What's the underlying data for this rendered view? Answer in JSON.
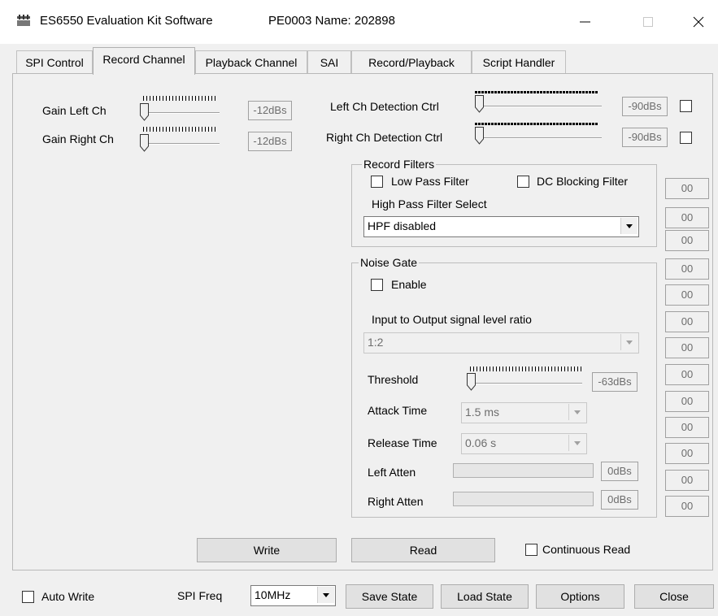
{
  "window": {
    "title": "ES6550 Evaluation Kit Software",
    "subtitle": "PE0003 Name: 202898",
    "minimize_icon": "minimize-icon",
    "maximize_icon": "maximize-icon",
    "close_icon": "close-icon"
  },
  "tabs": [
    {
      "label": "SPI Control"
    },
    {
      "label": "Record Channel"
    },
    {
      "label": "Playback Channel"
    },
    {
      "label": "SAI"
    },
    {
      "label": "Record/Playback"
    },
    {
      "label": "Script Handler"
    }
  ],
  "gain": {
    "left_label": "Gain Left Ch",
    "left_value": "-12dBs",
    "right_label": "Gain Right Ch",
    "right_value": "-12dBs"
  },
  "detection": {
    "left_label": "Left Ch Detection Ctrl",
    "left_value": "-90dBs",
    "right_label": "Right Ch Detection Ctrl",
    "right_value": "-90dBs"
  },
  "record_filters": {
    "legend": "Record Filters",
    "low_pass_label": "Low Pass Filter",
    "dc_blocking_label": "DC Blocking Filter",
    "hpf_label": "High Pass Filter Select",
    "hpf_value": "HPF disabled"
  },
  "noise_gate": {
    "legend": "Noise Gate",
    "enable_label": "Enable",
    "ratio_label": "Input to Output signal level ratio",
    "ratio_value": "1:2",
    "threshold_label": "Threshold",
    "threshold_value": "-63dBs",
    "attack_label": "Attack Time",
    "attack_value": "1.5 ms",
    "release_label": "Release Time",
    "release_value": "0.06 s",
    "left_atten_label": "Left Atten",
    "left_atten_value": "0dBs",
    "right_atten_label": "Right Atten",
    "right_atten_value": "0dBs"
  },
  "register_values": [
    "00",
    "00",
    "00",
    "00",
    "00",
    "00",
    "00",
    "00",
    "00",
    "00",
    "00",
    "00",
    "00",
    "00"
  ],
  "actions": {
    "write_label": "Write",
    "read_label": "Read",
    "continuous_read_label": "Continuous Read"
  },
  "footer": {
    "auto_write_label": "Auto Write",
    "spi_freq_label": "SPI Freq",
    "spi_freq_value": "10MHz",
    "save_state_label": "Save State",
    "load_state_label": "Load State",
    "options_label": "Options",
    "close_label": "Close"
  }
}
